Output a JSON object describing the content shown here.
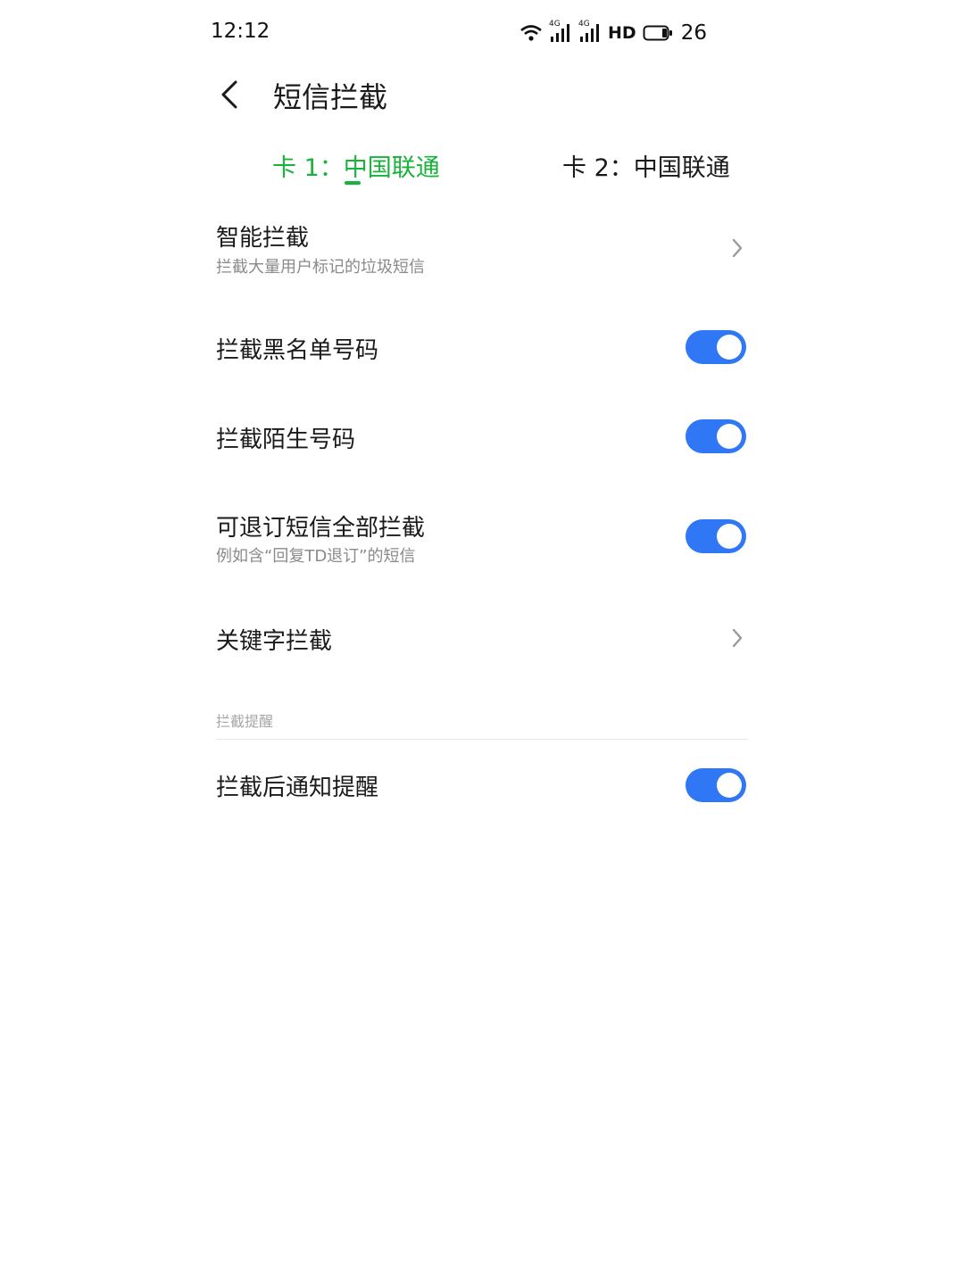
{
  "status_bar": {
    "time": "12:12",
    "net_label_1": "4G",
    "net_label_2": "4G",
    "hd_label": "HD",
    "battery": "26"
  },
  "header": {
    "title": "短信拦截"
  },
  "tabs": [
    {
      "label": "卡 1：中国联通",
      "active": true,
      "color": "#18b33a"
    },
    {
      "label": "卡 2：中国联通",
      "active": false
    }
  ],
  "settings": {
    "smart_block": {
      "title": "智能拦截",
      "subtitle": "拦截大量用户标记的垃圾短信"
    },
    "blacklist": {
      "title": "拦截黑名单号码",
      "enabled": true
    },
    "strangers": {
      "title": "拦截陌生号码",
      "enabled": true
    },
    "unsubscribable": {
      "title": "可退订短信全部拦截",
      "subtitle": "例如含“回复TD退订”的短信",
      "enabled": true
    },
    "keyword": {
      "title": "关键字拦截"
    }
  },
  "section_reminder": {
    "label": "拦截提醒",
    "notify": {
      "title": "拦截后通知提醒",
      "enabled": true
    }
  },
  "colors": {
    "accent_green": "#18b33a",
    "toggle_on": "#2f77f5"
  }
}
